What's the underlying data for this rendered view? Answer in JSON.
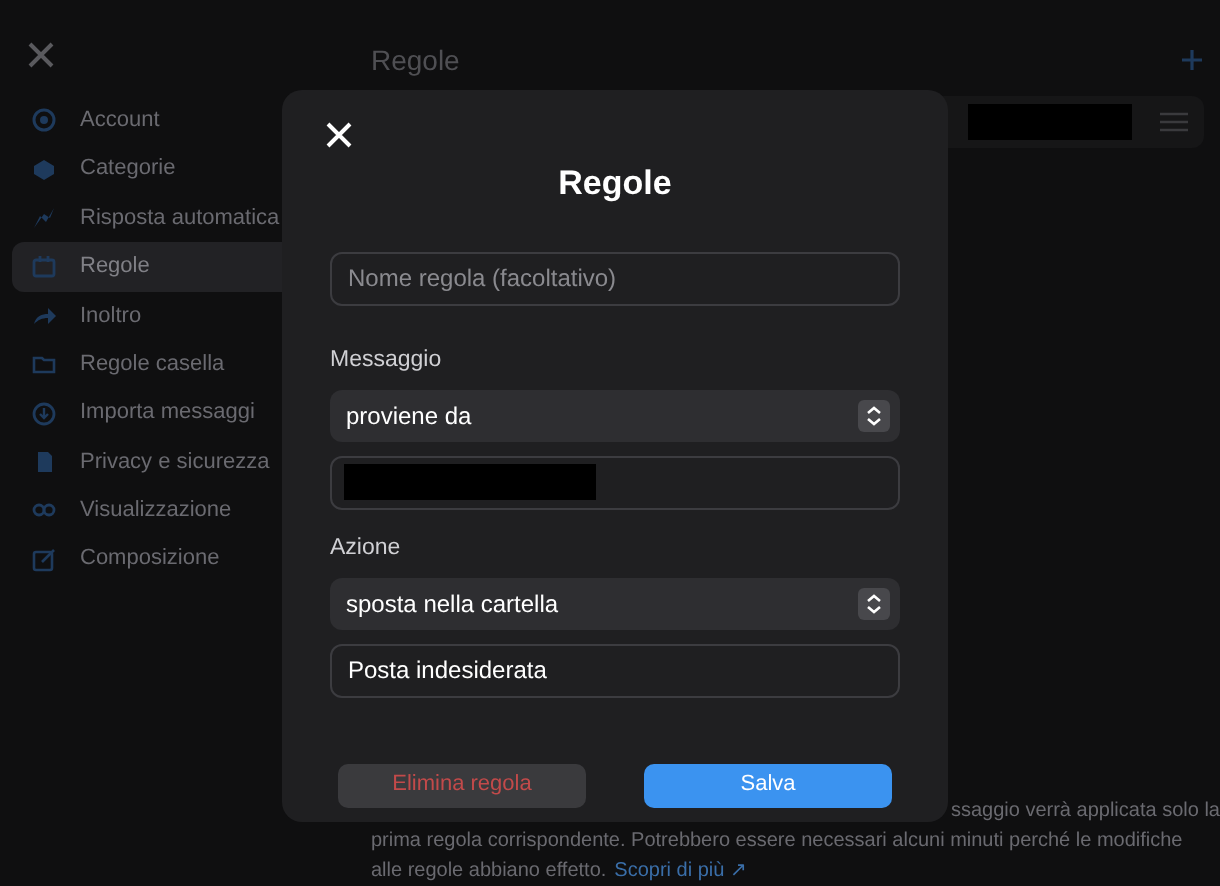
{
  "sidebar": {
    "items": [
      {
        "label": "Account",
        "selected": false
      },
      {
        "label": "Categorie",
        "selected": false
      },
      {
        "label": "Risposta automatica",
        "selected": false
      },
      {
        "label": "Regole",
        "selected": true
      },
      {
        "label": "Inoltro",
        "selected": false
      },
      {
        "label": "Regole casella",
        "selected": false
      },
      {
        "label": "Importa messaggi",
        "selected": false
      },
      {
        "label": "Privacy e sicurezza",
        "selected": false
      },
      {
        "label": "Visualizzazione",
        "selected": false
      },
      {
        "label": "Composizione",
        "selected": false
      }
    ]
  },
  "page": {
    "title": "Regole",
    "footer_line_1": "ssaggio verrà applicata solo la",
    "footer_line_2": "prima regola corrispondente. Potrebbero essere necessari alcuni minuti perché le modifiche",
    "footer_line_3": "alle regole abbiano effetto.",
    "footer_link": "Scopri di più ↗"
  },
  "dialog": {
    "title": "Regole",
    "name_field": {
      "placeholder": "Nome regola (facoltativo)"
    },
    "sections": [
      {
        "label": "Messaggio",
        "select": "proviene da",
        "input": {
          "redacted": true
        }
      },
      {
        "label": "Azione",
        "select": "sposta nella cartella",
        "input": {
          "redacted": false,
          "value": "Posta indesiderata"
        }
      }
    ],
    "buttons": {
      "delete": "Elimina regola",
      "save": "Salva"
    }
  }
}
